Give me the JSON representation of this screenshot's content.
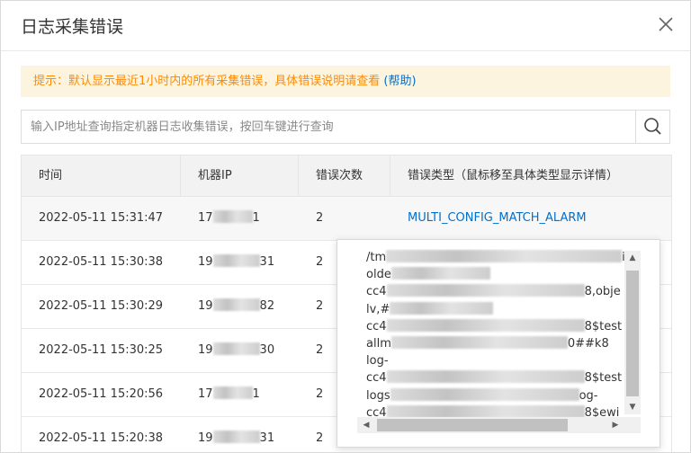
{
  "dialog": {
    "title": "日志采集错误",
    "close_icon": "close-icon"
  },
  "tip": {
    "text": "提示：默认显示最近1小时内的所有采集错误，具体错误说明请查看 ",
    "link": "(帮助)"
  },
  "search": {
    "placeholder": "输入IP地址查询指定机器日志收集错误，按回车键进行查询",
    "icon": "search-icon"
  },
  "table": {
    "headers": [
      "时间",
      "机器IP",
      "错误次数",
      "错误类型（鼠标移至具体类型显示详情）"
    ],
    "rows": [
      {
        "time": "2022-05-11 15:31:47",
        "ip_prefix": "17",
        "ip_suffix": "1",
        "count": "2",
        "type": "MULTI_CONFIG_MATCH_ALARM"
      },
      {
        "time": "2022-05-11 15:30:38",
        "ip_prefix": "19",
        "ip_suffix": "31",
        "count": "2",
        "type": ""
      },
      {
        "time": "2022-05-11 15:30:29",
        "ip_prefix": "19",
        "ip_suffix": "82",
        "count": "2",
        "type": ""
      },
      {
        "time": "2022-05-11 15:30:25",
        "ip_prefix": "19",
        "ip_suffix": "30",
        "count": "2",
        "type": ""
      },
      {
        "time": "2022-05-11 15:20:56",
        "ip_prefix": "17",
        "ip_suffix": "1",
        "count": "2",
        "type": ""
      },
      {
        "time": "2022-05-11 15:20:38",
        "ip_prefix": "19",
        "ip_suffix": "31",
        "count": "2",
        "type": ""
      }
    ]
  },
  "popover": {
    "lines": [
      {
        "pre": "/tm",
        "suf": "i"
      },
      {
        "pre": "olde",
        "suf": ""
      },
      {
        "pre": "cc4",
        "suf": "8,obje"
      },
      {
        "pre": "lv,#",
        "suf": ""
      },
      {
        "pre": "cc4",
        "suf": "8$test"
      },
      {
        "pre": "allm",
        "suf": "0##k8"
      },
      {
        "pre": "log-",
        "suf": ""
      },
      {
        "pre": "cc4",
        "suf": "8$test"
      },
      {
        "pre": "logs",
        "suf": "og-"
      },
      {
        "pre": "cc4",
        "suf": "8$ewi"
      }
    ],
    "scroll_up_icon": "arrow-up-icon",
    "scroll_down_icon": "arrow-down-icon",
    "scroll_left_icon": "arrow-left-icon",
    "scroll_right_icon": "arrow-right-icon"
  }
}
